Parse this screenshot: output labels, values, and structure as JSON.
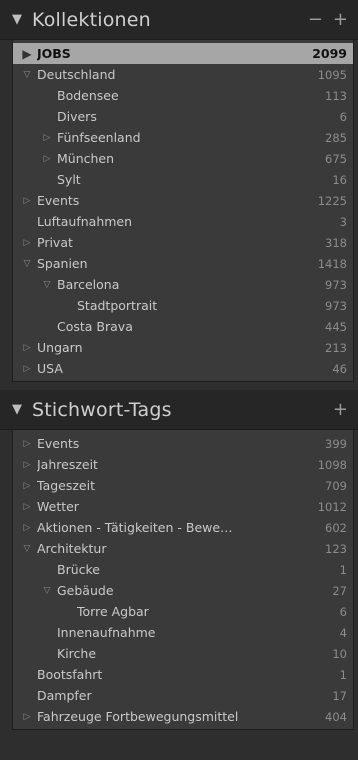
{
  "collections": {
    "title": "Kollektionen",
    "remove_label": "−",
    "add_label": "+",
    "items": [
      {
        "label": "JOBS",
        "count": "2099",
        "level": 0,
        "disc": "play",
        "selected": true
      },
      {
        "label": "Deutschland",
        "count": "1095",
        "level": 0,
        "disc": "open"
      },
      {
        "label": "Bodensee",
        "count": "113",
        "level": 1,
        "disc": "none"
      },
      {
        "label": "Divers",
        "count": "6",
        "level": 1,
        "disc": "none"
      },
      {
        "label": "Fünfseenland",
        "count": "285",
        "level": 1,
        "disc": "closed"
      },
      {
        "label": "München",
        "count": "675",
        "level": 1,
        "disc": "closed"
      },
      {
        "label": "Sylt",
        "count": "16",
        "level": 1,
        "disc": "none"
      },
      {
        "label": "Events",
        "count": "1225",
        "level": 0,
        "disc": "closed"
      },
      {
        "label": "Luftaufnahmen",
        "count": "3",
        "level": 0,
        "disc": "none"
      },
      {
        "label": "Privat",
        "count": "318",
        "level": 0,
        "disc": "closed"
      },
      {
        "label": "Spanien",
        "count": "1418",
        "level": 0,
        "disc": "open"
      },
      {
        "label": "Barcelona",
        "count": "973",
        "level": 1,
        "disc": "open"
      },
      {
        "label": "Stadtportrait",
        "count": "973",
        "level": 2,
        "disc": "none"
      },
      {
        "label": "Costa Brava",
        "count": "445",
        "level": 1,
        "disc": "none"
      },
      {
        "label": "Ungarn",
        "count": "213",
        "level": 0,
        "disc": "closed"
      },
      {
        "label": "USA",
        "count": "46",
        "level": 0,
        "disc": "closed"
      }
    ]
  },
  "keywords": {
    "title": "Stichwort-Tags",
    "add_label": "+",
    "items": [
      {
        "label": "Events",
        "count": "399",
        "level": 0,
        "disc": "closed"
      },
      {
        "label": "Jahreszeit",
        "count": "1098",
        "level": 0,
        "disc": "closed"
      },
      {
        "label": "Tageszeit",
        "count": "709",
        "level": 0,
        "disc": "closed"
      },
      {
        "label": "Wetter",
        "count": "1012",
        "level": 0,
        "disc": "closed"
      },
      {
        "label": "Aktionen - Tätigkeiten - Bewe…",
        "count": "602",
        "level": 0,
        "disc": "closed"
      },
      {
        "label": "Architektur",
        "count": "123",
        "level": 0,
        "disc": "open"
      },
      {
        "label": "Brücke",
        "count": "1",
        "level": 1,
        "disc": "none"
      },
      {
        "label": "Gebäude",
        "count": "27",
        "level": 1,
        "disc": "open"
      },
      {
        "label": "Torre Agbar",
        "count": "6",
        "level": 2,
        "disc": "none"
      },
      {
        "label": "Innenaufnahme",
        "count": "4",
        "level": 1,
        "disc": "none"
      },
      {
        "label": "Kirche",
        "count": "10",
        "level": 1,
        "disc": "none"
      },
      {
        "label": "Bootsfahrt",
        "count": "1",
        "level": 0,
        "disc": "none"
      },
      {
        "label": "Dampfer",
        "count": "17",
        "level": 0,
        "disc": "none"
      },
      {
        "label": "Fahrzeuge Fortbewegungsmittel",
        "count": "404",
        "level": 0,
        "disc": "closed"
      }
    ]
  }
}
